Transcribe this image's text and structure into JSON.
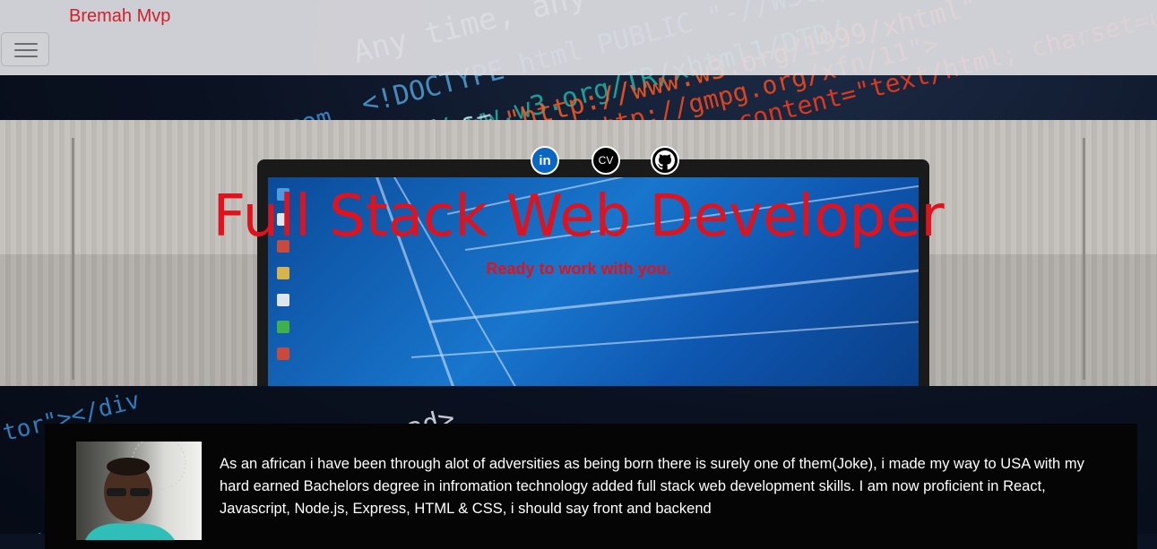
{
  "navbar": {
    "brand": "Bremah Mvp",
    "toggler_icon": "hamburger-icon"
  },
  "hero": {
    "social": [
      {
        "name": "linkedin",
        "icon": "linkedin-icon",
        "label": "in"
      },
      {
        "name": "cv",
        "icon": "cv-icon",
        "label": "CV"
      },
      {
        "name": "github",
        "icon": "github-icon",
        "label": ""
      }
    ],
    "title": "Full Stack Web Developer",
    "subtitle": "Ready to work with you."
  },
  "about": {
    "text": "As an african i have been through alot of adversities as being born there is surely one of them(Joke), i made my way to USA with my hard earned Bachelors degree in infromation technology added full stack web development skills. I am now proficient in React, Javascript, Node.js, Express, HTML & CSS, i should say front and backend"
  },
  "colors": {
    "accent": "#e0121d",
    "brand": "#d0202a",
    "navbar_bg": "#dedee2",
    "about_bg": "#050505"
  }
}
